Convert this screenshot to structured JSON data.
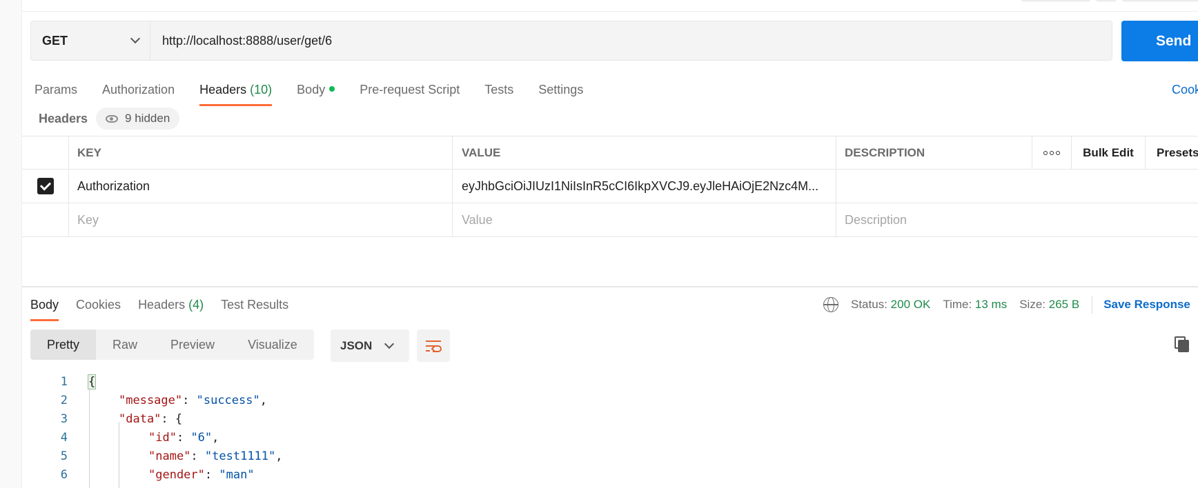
{
  "request": {
    "method": "GET",
    "url": "http://localhost:8888/user/get/6",
    "send_label": "Send"
  },
  "req_tabs": [
    {
      "label": "Params"
    },
    {
      "label": "Authorization"
    },
    {
      "label": "Headers",
      "count": "(10)"
    },
    {
      "label": "Body"
    },
    {
      "label": "Pre-request Script"
    },
    {
      "label": "Tests"
    },
    {
      "label": "Settings"
    }
  ],
  "cookies_label": "Cookies",
  "headers_section": {
    "label": "Headers",
    "hidden": "9 hidden"
  },
  "table": {
    "columns": [
      "KEY",
      "VALUE",
      "DESCRIPTION"
    ],
    "bulk_edit": "Bulk Edit",
    "presets": "Presets",
    "rows": [
      {
        "checked": true,
        "key": "Authorization",
        "value": "eyJhbGciOiJIUzI1NiIsInR5cCI6IkpXVCJ9.eyJleHAiOjE2Nzc4M...",
        "description": ""
      }
    ],
    "placeholder": {
      "key": "Key",
      "value": "Value",
      "description": "Description"
    }
  },
  "res_tabs": [
    {
      "label": "Body"
    },
    {
      "label": "Cookies"
    },
    {
      "label": "Headers",
      "count": "(4)"
    },
    {
      "label": "Test Results"
    }
  ],
  "response_status": {
    "status_label": "Status:",
    "status": "200 OK",
    "time_label": "Time:",
    "time": "13 ms",
    "size_label": "Size:",
    "size": "265 B",
    "save_label": "Save Response"
  },
  "view_modes": [
    "Pretty",
    "Raw",
    "Preview",
    "Visualize"
  ],
  "format": "JSON",
  "icons": {
    "method_dropdown": "chevron-down-icon",
    "hidden_headers": "eye-icon",
    "more_actions": "more-dots-icon",
    "network": "globe-icon",
    "wrap": "wrap-lines-icon",
    "copy": "copy-icon"
  },
  "colors": {
    "accent": "#ff6c37",
    "send": "#0c7ce6",
    "link": "#0b6bcb",
    "success": "#1f8a4c"
  },
  "code_lines": [
    {
      "n": "1",
      "text": "{"
    },
    {
      "n": "2",
      "key": "\"message\"",
      "value": "\"success\"",
      "tail": ","
    },
    {
      "n": "3",
      "key": "\"data\"",
      "tail": "{"
    },
    {
      "n": "4",
      "key": "\"id\"",
      "value": "\"6\"",
      "tail": ","
    },
    {
      "n": "5",
      "key": "\"name\"",
      "value": "\"test1111\"",
      "tail": ","
    },
    {
      "n": "6",
      "key": "\"gender\"",
      "value": "\"man\"",
      "tail": ""
    }
  ]
}
